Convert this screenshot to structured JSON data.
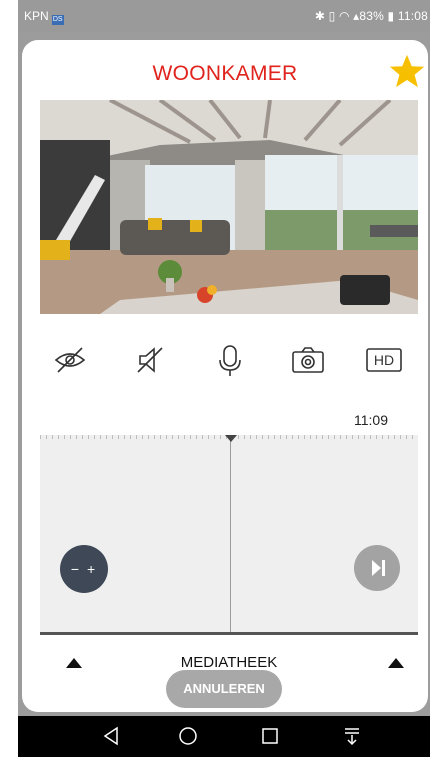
{
  "status": {
    "carrier": "KPN",
    "carrier_badge": "DS",
    "right": "✱ ▯ ◠ ▴83% ▮ 11:08"
  },
  "header": {
    "title": "WOONKAMER",
    "favorite_icon": "star-icon",
    "accent": "#e0231c",
    "star_color": "#f6c000"
  },
  "video": {
    "icon": "camera-live-feed"
  },
  "toolbar": {
    "items": [
      {
        "name": "eye-off-icon"
      },
      {
        "name": "speaker-mute-icon"
      },
      {
        "name": "microphone-icon"
      },
      {
        "name": "camera-snapshot-icon"
      },
      {
        "name": "hd-icon",
        "label": "HD"
      }
    ]
  },
  "timeline": {
    "current_time": "11:09",
    "zoom_label": "− +",
    "next_icon": "skip-next-icon"
  },
  "media": {
    "label": "MEDIATHEEK"
  },
  "actions": {
    "cancel_label": "ANNULEREN"
  },
  "navbar": {
    "items": [
      "back-icon",
      "home-icon",
      "recents-icon",
      "notifications-icon"
    ]
  }
}
